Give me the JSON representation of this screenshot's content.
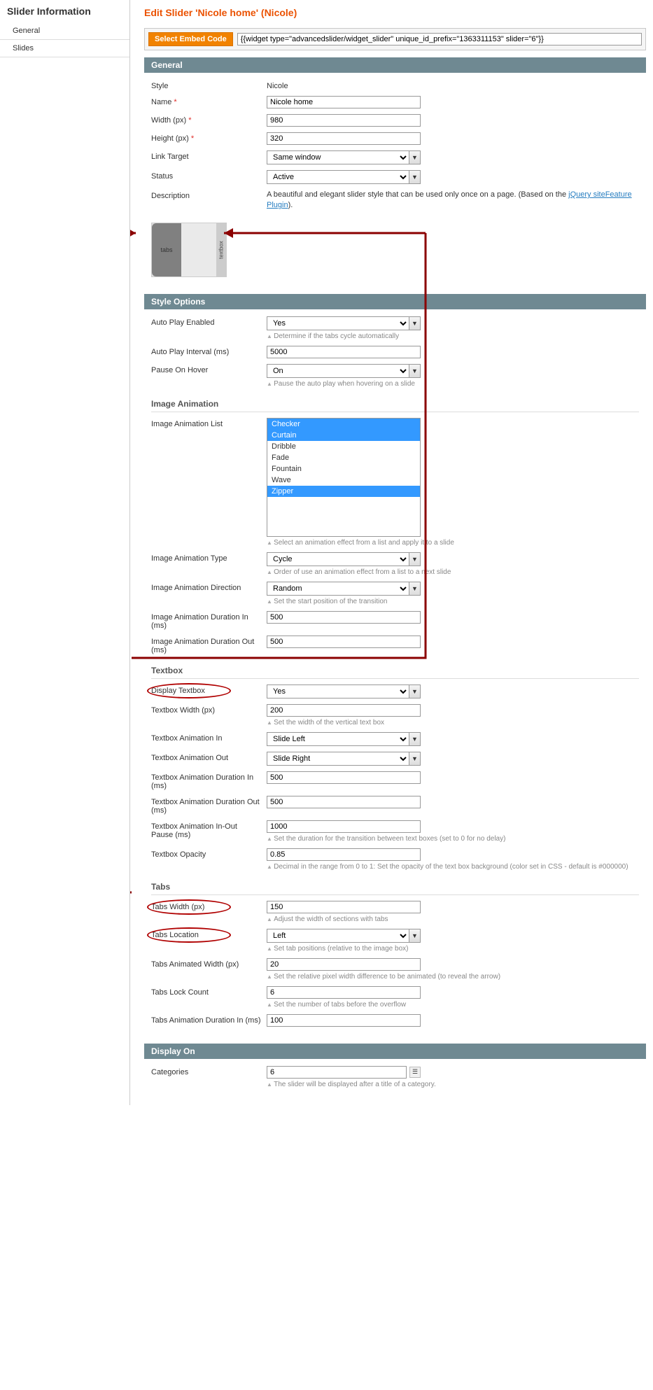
{
  "sidebar": {
    "title": "Slider Information",
    "tabs": [
      {
        "label": "General",
        "active": true
      },
      {
        "label": "Slides",
        "active": false
      }
    ]
  },
  "page": {
    "title": "Edit Slider 'Nicole home' (Nicole)"
  },
  "embed": {
    "button": "Select Embed Code",
    "code": "{{widget type=\"advancedslider/widget_slider\" unique_id_prefix=\"1363311153\" slider=\"6\"}}"
  },
  "sections": {
    "general": "General",
    "styleOptions": "Style Options",
    "displayOn": "Display On"
  },
  "general": {
    "style_label": "Style",
    "style_value": "Nicole",
    "name_label": "Name",
    "name_value": "Nicole home",
    "width_label": "Width (px)",
    "width_value": "980",
    "height_label": "Height (px)",
    "height_value": "320",
    "linkTarget_label": "Link Target",
    "linkTarget_value": "Same window",
    "status_label": "Status",
    "status_value": "Active",
    "description_label": "Description",
    "description_text": "A beautiful and elegant slider style that can be used only once on a page. (Based on the ",
    "description_link": "jQuery siteFeature Plugin",
    "description_after": ").",
    "img_tabs": "tabs",
    "img_textbox": "textbox"
  },
  "styleOptions": {
    "autoplay_label": "Auto Play Enabled",
    "autoplay_value": "Yes",
    "autoplay_hint": "Determine if the tabs cycle automatically",
    "interval_label": "Auto Play Interval (ms)",
    "interval_value": "5000",
    "pause_label": "Pause On Hover",
    "pause_value": "On",
    "pause_hint": "Pause the auto play when hovering on a slide"
  },
  "imageAnim": {
    "heading": "Image Animation",
    "list_label": "Image Animation List",
    "list_options": [
      {
        "label": "Checker",
        "selected": true
      },
      {
        "label": "Curtain",
        "selected": true
      },
      {
        "label": "Dribble",
        "selected": false
      },
      {
        "label": "Fade",
        "selected": false
      },
      {
        "label": "Fountain",
        "selected": false
      },
      {
        "label": "Wave",
        "selected": false
      },
      {
        "label": "Zipper",
        "selected": true
      }
    ],
    "list_hint": "Select an animation effect from a list and apply it to a slide",
    "type_label": "Image Animation Type",
    "type_value": "Cycle",
    "type_hint": "Order of use an animation effect from a list to a next slide",
    "direction_label": "Image Animation Direction",
    "direction_value": "Random",
    "direction_hint": "Set the start position of the transition",
    "durIn_label": "Image Animation Duration In (ms)",
    "durIn_value": "500",
    "durOut_label": "Image Animation Duration Out (ms)",
    "durOut_value": "500"
  },
  "textbox": {
    "heading": "Textbox",
    "display_label": "Display Textbox",
    "display_value": "Yes",
    "width_label": "Textbox Width (px)",
    "width_value": "200",
    "width_hint": "Set the width of the vertical text box",
    "animIn_label": "Textbox Animation In",
    "animIn_value": "Slide Left",
    "animOut_label": "Textbox Animation Out",
    "animOut_value": "Slide Right",
    "durIn_label": "Textbox Animation Duration In (ms)",
    "durIn_value": "500",
    "durOut_label": "Textbox Animation Duration Out (ms)",
    "durOut_value": "500",
    "pause_label": "Textbox Animation In-Out Pause (ms)",
    "pause_value": "1000",
    "pause_hint": "Set the duration for the transition between text boxes (set to 0 for no delay)",
    "opacity_label": "Textbox Opacity",
    "opacity_value": "0.85",
    "opacity_hint": "Decimal in the range from 0 to 1: Set the opacity of the text box background (color set in CSS - default is #000000)"
  },
  "tabs": {
    "heading": "Tabs",
    "width_label": "Tabs Width (px)",
    "width_value": "150",
    "width_hint": "Adjust the width of sections with tabs",
    "location_label": "Tabs Location",
    "location_value": "Left",
    "location_hint": "Set tab positions (relative to the image box)",
    "animWidth_label": "Tabs Animated Width (px)",
    "animWidth_value": "20",
    "animWidth_hint": "Set the relative pixel width difference to be animated (to reveal the arrow)",
    "lockCount_label": "Tabs Lock Count",
    "lockCount_value": "6",
    "lockCount_hint": "Set the number of tabs before the overflow",
    "animDur_label": "Tabs Animation Duration In (ms)",
    "animDur_value": "100"
  },
  "displayOn": {
    "categories_label": "Categories",
    "categories_value": "6",
    "categories_hint": "The slider will be displayed after a title of a category."
  },
  "required": "*"
}
